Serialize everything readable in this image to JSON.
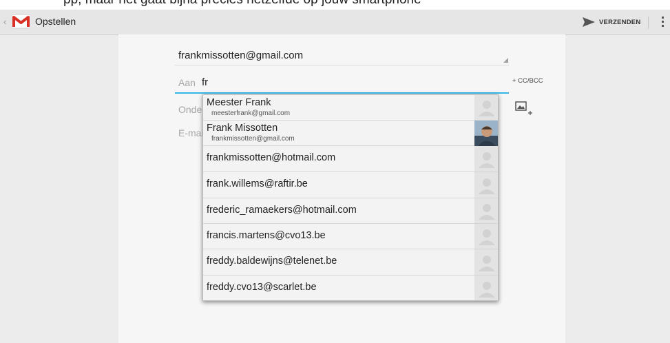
{
  "top_cut_text": "pp, maar het gaat bijna precies hetzelfde op jouw smartphone",
  "actionbar": {
    "title": "Opstellen",
    "send_label": "VERZENDEN",
    "icons": {
      "back": "chevron-left-icon",
      "logo": "gmail-logo-icon",
      "send": "send-arrow-icon",
      "overflow": "overflow-menu-icon",
      "attach": "add-picture-icon"
    }
  },
  "compose": {
    "from": "frankmissotten@gmail.com",
    "to_label": "Aan",
    "to_value": "fr",
    "cc_bcc": "+ CC/BCC",
    "subject_placeholder": "Onderwerp",
    "body_placeholder": "E-mail opstellen"
  },
  "suggestions": [
    {
      "name": "Meester Frank",
      "email": "meesterfrank@gmail.com",
      "photo": false
    },
    {
      "name": "Frank Missotten",
      "email": "frankmissotten@gmail.com",
      "photo": true
    },
    {
      "email": "frankmissotten@hotmail.com"
    },
    {
      "email": "frank.willems@raftir.be"
    },
    {
      "email": "frederic_ramaekers@hotmail.com"
    },
    {
      "email": "francis.martens@cvo13.be"
    },
    {
      "email": "freddy.baldewijns@telenet.be"
    },
    {
      "email": "freddy.cvo13@scarlet.be"
    }
  ],
  "colors": {
    "accent": "#33b5e5",
    "gmail_red": "#d93025"
  }
}
